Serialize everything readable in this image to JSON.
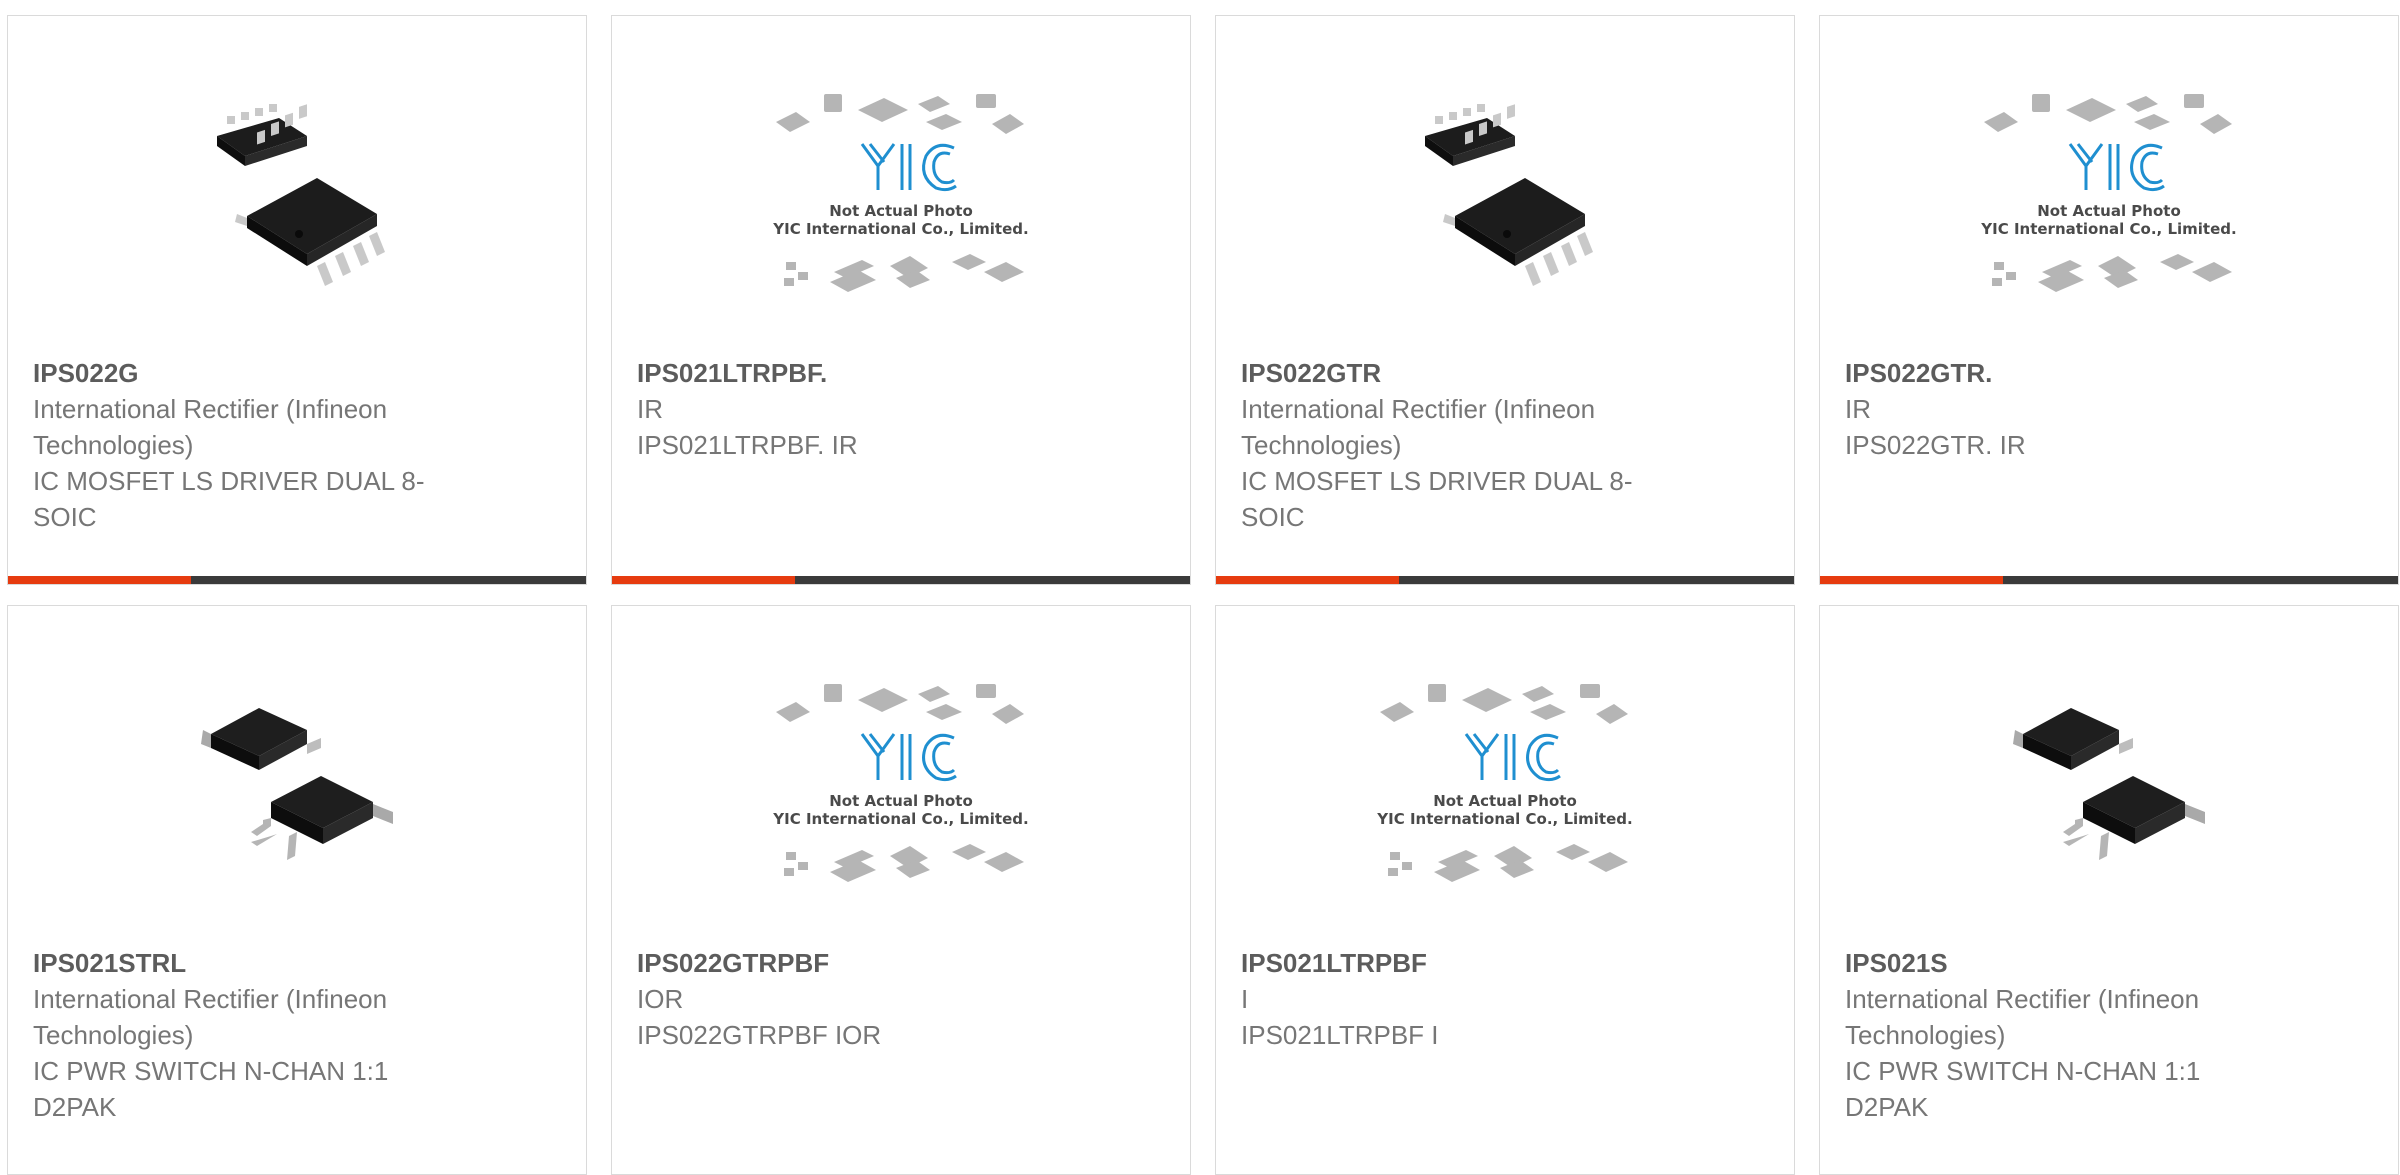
{
  "colors": {
    "accent": "#e63b0f",
    "bar": "#3a3a3a",
    "logo_blue": "#1f8fd0"
  },
  "products": [
    {
      "part_number": "IPS022G",
      "manufacturer": "International Rectifier (Infineon Technologies)",
      "description": "IC MOSFET LS DRIVER DUAL 8-SOIC",
      "image": "soic-8-package-icon"
    },
    {
      "part_number": "IPS021LTRPBF.",
      "manufacturer": "IR",
      "description": "IPS021LTRPBF. IR",
      "image": "not-actual-photo-placeholder",
      "placeholder_line1": "Not Actual Photo",
      "placeholder_line2": "YIC International Co., Limited."
    },
    {
      "part_number": "IPS022GTR",
      "manufacturer": "International Rectifier (Infineon Technologies)",
      "description": "IC MOSFET LS DRIVER DUAL 8-SOIC",
      "image": "soic-8-package-icon"
    },
    {
      "part_number": "IPS022GTR.",
      "manufacturer": "IR",
      "description": "IPS022GTR. IR",
      "image": "not-actual-photo-placeholder",
      "placeholder_line1": "Not Actual Photo",
      "placeholder_line2": "YIC International Co., Limited."
    },
    {
      "part_number": "IPS021STRL",
      "manufacturer": "International Rectifier (Infineon Technologies)",
      "description": "IC PWR SWITCH N-CHAN 1:1 D2PAK",
      "image": "d2pak-package-icon"
    },
    {
      "part_number": "IPS022GTRPBF",
      "manufacturer": "IOR",
      "description": "IPS022GTRPBF IOR",
      "image": "not-actual-photo-placeholder",
      "placeholder_line1": "Not Actual Photo",
      "placeholder_line2": "YIC International Co., Limited."
    },
    {
      "part_number": "IPS021LTRPBF",
      "manufacturer": "I",
      "description": "IPS021LTRPBF I",
      "image": "not-actual-photo-placeholder",
      "placeholder_line1": "Not Actual Photo",
      "placeholder_line2": "YIC International Co., Limited."
    },
    {
      "part_number": "IPS021S",
      "manufacturer": "International Rectifier (Infineon Technologies)",
      "description": "IC PWR SWITCH N-CHAN 1:1 D2PAK",
      "image": "d2pak-package-icon"
    }
  ]
}
